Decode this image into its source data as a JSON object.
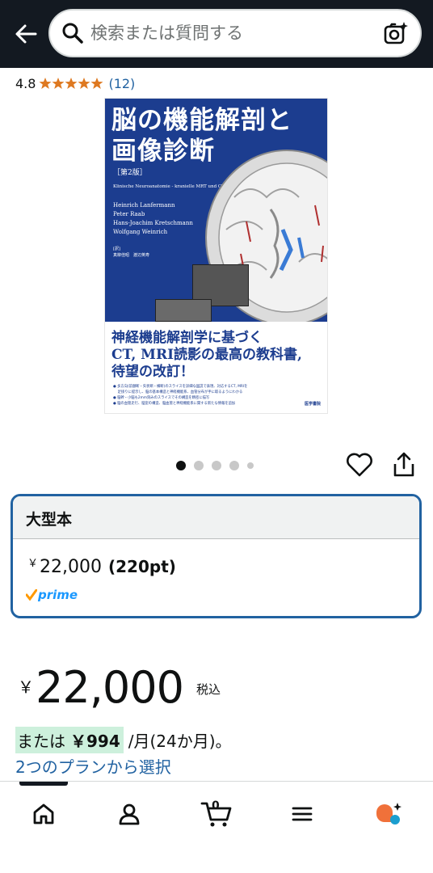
{
  "header": {
    "search_placeholder": "検索または質問する"
  },
  "rating": {
    "value": "4.8",
    "stars": 5,
    "count": "(12)",
    "star_color": "#de7921"
  },
  "book": {
    "title_line1": "脳の機能解剖と",
    "title_line2": "画像診断",
    "edition": "［第2版］",
    "subtitle": "Klinische Neuroanatomie - kranielle MRT und CT, 4e",
    "authors": [
      "Heinrich Lanfermann",
      "Peter Raab",
      "Hans-Joachim Kretschmann",
      "Wolfgang Weinrich"
    ],
    "translators_label": "[訳]",
    "translators": "真柳佳昭　渡辺英寿",
    "tagline": [
      "神経機能解剖学に基づく",
      "CT, MRI読影の最高の教科書,",
      "待望の改訂！"
    ],
    "bullets": [
      "● 多方向(前額断・矢状断・横断)のスライスを詳細な図説で表現、対応するCT, MRIを",
      "　 足掛りに提示し、脳の基本構造と神経機能系、血管分布が手に取るようにわかる",
      "● 脳幹・小脳も2mm刻みのスライスでその構造を精密に描写",
      "● 脳の血管走行、脳室の構造、脳血管と神経機能系に関する新たな情報を追加"
    ],
    "publisher": "医学書院",
    "cover_color": "#1c3d8f"
  },
  "gallery": {
    "dot_count": 5,
    "active_index": 0
  },
  "format": {
    "title": "大型本",
    "yen": "￥",
    "price": "22,000",
    "points": "(220pt)",
    "prime_label": "prime"
  },
  "price": {
    "yen": "￥",
    "amount": "22,000",
    "tax_label": "税込"
  },
  "installment": {
    "prefix": "または",
    "amount": "￥994",
    "suffix": "/月(24か月)。",
    "plan_link": "2つのプランから選択"
  },
  "bottom_nav": {
    "cart_count": "0",
    "items": [
      "home-icon",
      "account-icon",
      "cart-icon",
      "menu-icon",
      "rufus-icon"
    ]
  }
}
